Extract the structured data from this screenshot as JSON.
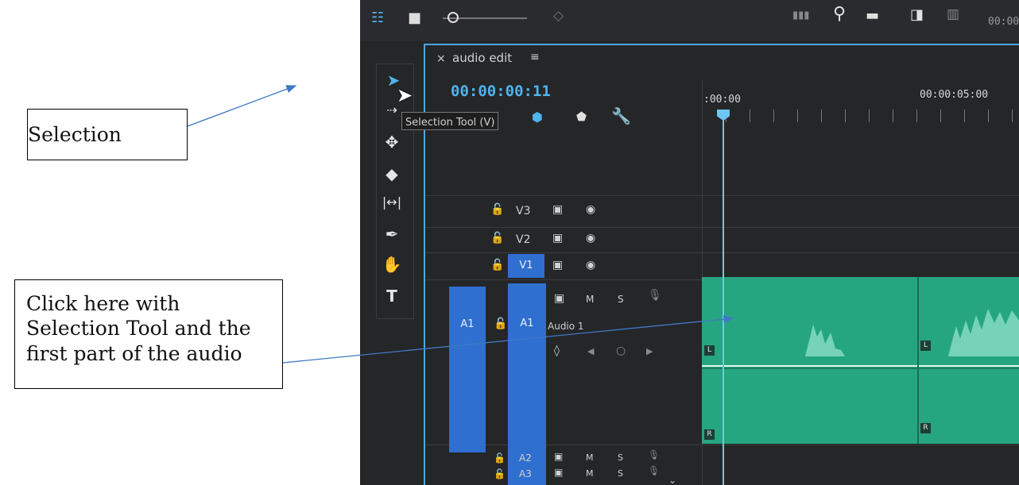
{
  "callouts": {
    "selection": "Selection",
    "click_note": "Click here with Selection Tool and the first part of the audio"
  },
  "topbar": {
    "timecode_partial": "00:00"
  },
  "sequence": {
    "close_label": "×",
    "name": "audio edit",
    "menu_label": "≡",
    "timecode": "00:00:00:11",
    "tooltip": "Selection Tool (V)"
  },
  "ruler": {
    "start": ":00:00",
    "mark": "00:00:05:00"
  },
  "tracks": {
    "v3": "V3",
    "v2": "V2",
    "v1": "V1",
    "a1_source": "A1",
    "a1": "A1",
    "audio_name": "Audio 1",
    "mute": "M",
    "solo": "S",
    "a2": "A2",
    "a3": "A3",
    "left_label": "L",
    "right_label": "R"
  },
  "colors": {
    "accent": "#4ea8e0",
    "track_blue": "#2f6fd0",
    "audio_clip": "#26a680"
  }
}
